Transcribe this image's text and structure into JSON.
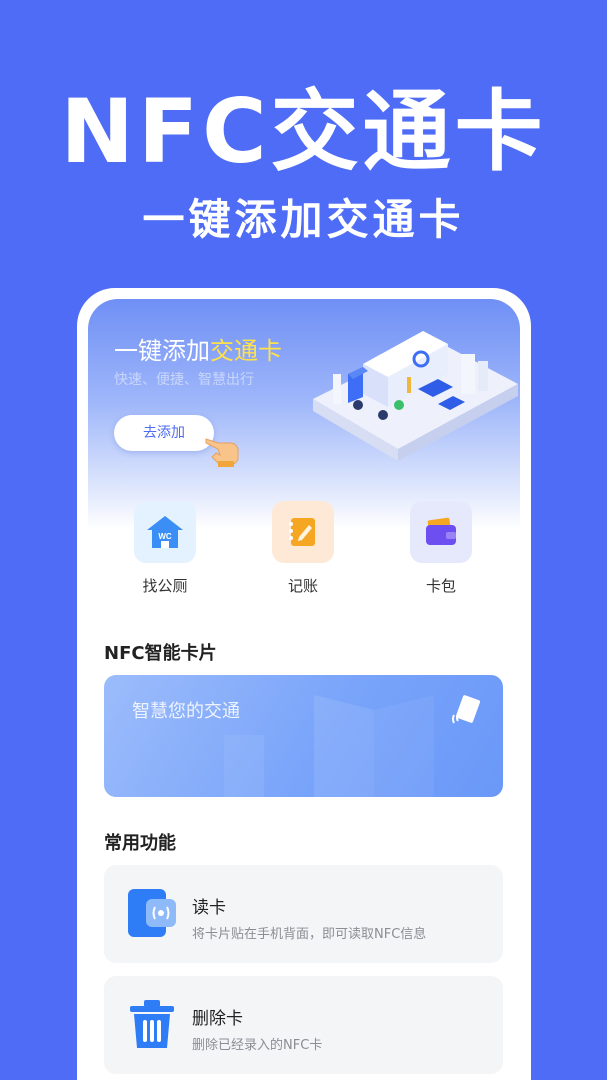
{
  "promo": {
    "title": "NFC交通卡",
    "subtitle": "一键添加交通卡"
  },
  "banner": {
    "title_prefix": "一键添加",
    "title_highlight": "交通卡",
    "subtitle": "快速、便捷、智慧出行",
    "add_button_label": "去添加"
  },
  "quick_actions": [
    {
      "label": "找公厕",
      "icon": "toilet-house-icon",
      "badge": "WC",
      "color": "#3b8ef5",
      "tile": "#e4f1fe"
    },
    {
      "label": "记账",
      "icon": "notebook-pencil-icon",
      "color": "#f5a623",
      "tile": "#fde9d6"
    },
    {
      "label": "卡包",
      "icon": "wallet-icon",
      "color": "#6d4ef0",
      "tile": "#e6e9fb"
    }
  ],
  "nfc_section": {
    "title": "NFC智能卡片",
    "card_text": "智慧您的交通"
  },
  "common_section": {
    "title": "常用功能",
    "items": [
      {
        "name": "读卡",
        "desc": "将卡片贴在手机背面，即可读取NFC信息",
        "icon": "nfc-reader-icon"
      },
      {
        "name": "删除卡",
        "desc": "删除已经录入的NFC卡",
        "icon": "trash-icon"
      }
    ]
  },
  "colors": {
    "background": "#4f6cf7",
    "accent": "#4f6cf7",
    "highlight": "#ffe14a",
    "icon_blue": "#2f7df6"
  }
}
